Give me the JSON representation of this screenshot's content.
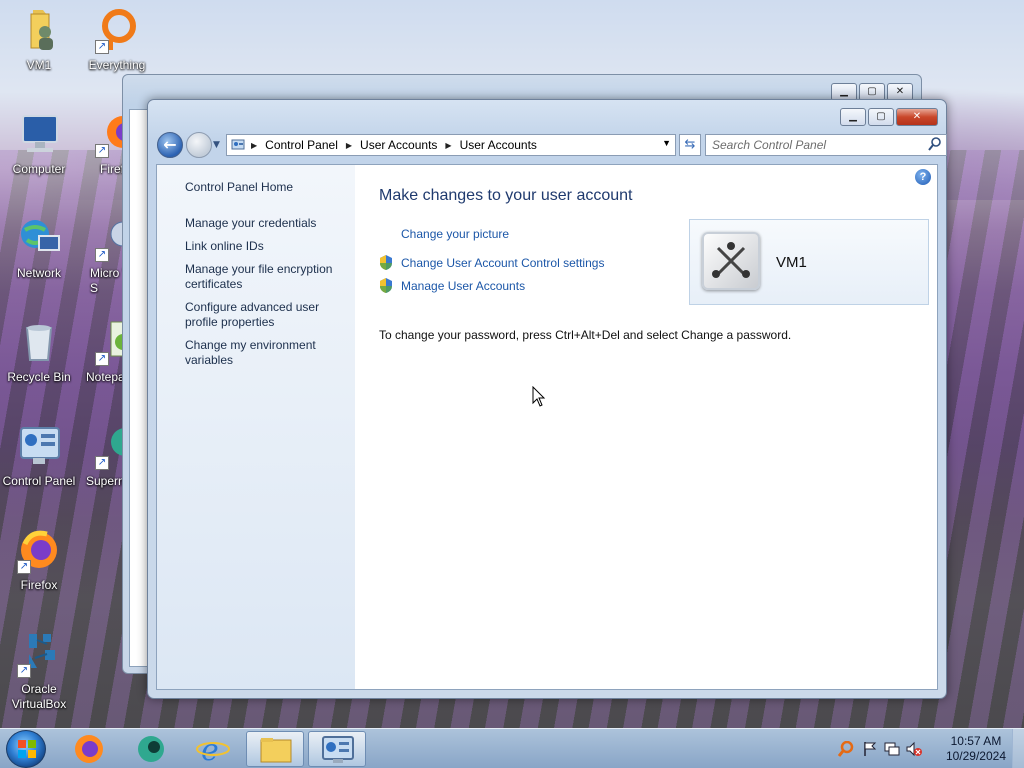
{
  "desktop": {
    "icons": [
      {
        "label": "VM1"
      },
      {
        "label": "Everything"
      },
      {
        "label": "Computer"
      },
      {
        "label": "Firef"
      },
      {
        "label": "Network"
      },
      {
        "label": "Micro Visual S"
      },
      {
        "label": "Recycle Bin"
      },
      {
        "label": "Notepa"
      },
      {
        "label": "Control Panel"
      },
      {
        "label": "Supern"
      },
      {
        "label": "Firefox"
      },
      {
        "label": "Oracle VirtualBox"
      }
    ]
  },
  "window": {
    "address": {
      "crumbs": [
        "Control Panel",
        "User Accounts",
        "User Accounts"
      ]
    },
    "search": {
      "placeholder": "Search Control Panel"
    },
    "controls": {
      "minimize": "▭",
      "maximize": "▢",
      "close": "✕"
    },
    "left_pane": {
      "home": "Control Panel Home",
      "links": [
        "Manage your credentials",
        "Link online IDs",
        "Manage your file encryption certificates",
        "Configure advanced user profile properties",
        "Change my environment variables"
      ]
    },
    "main": {
      "title": "Make changes to your user account",
      "links": [
        {
          "label": "Change your picture",
          "shield": false
        },
        {
          "label": "Change User Account Control settings",
          "shield": true
        },
        {
          "label": "Manage User Accounts",
          "shield": true
        }
      ],
      "note": "To change your password, press Ctrl+Alt+Del and select Change a password.",
      "user": {
        "name": "VM1"
      },
      "help_label": "?"
    }
  },
  "taskbar": {
    "clock": {
      "time": "10:57 AM",
      "date": "10/29/2024"
    }
  }
}
